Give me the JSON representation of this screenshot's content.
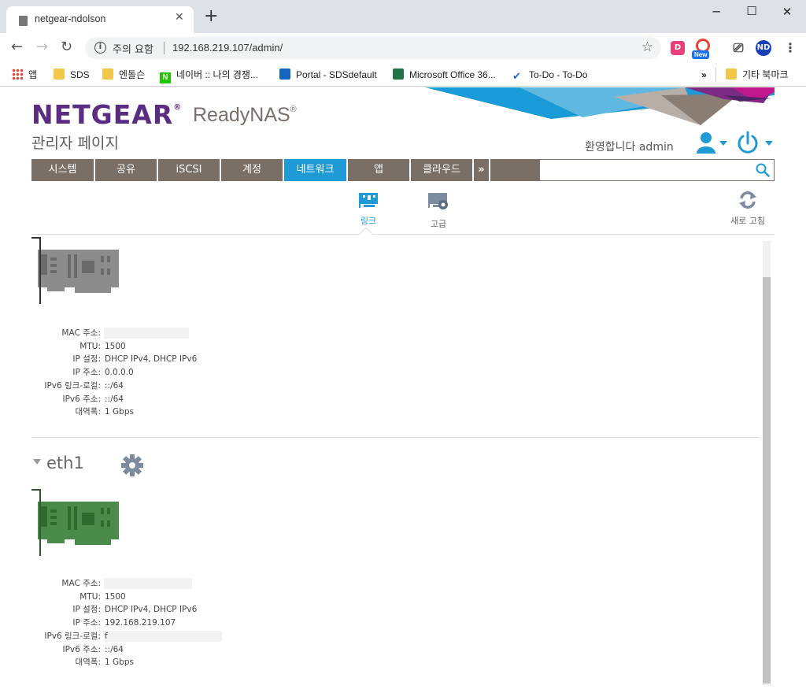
{
  "browser": {
    "tab_title": "netgear-ndolson",
    "security_status": "주의 요함",
    "url": "192.168.219.107/admin/",
    "ext_new_badge": "New",
    "profile_initials": "ND",
    "ext_d_label": "D"
  },
  "bookmarks": {
    "items": [
      {
        "label": "앱",
        "icon": "apps-grid-icon"
      },
      {
        "label": "SDS",
        "icon": "folder-icon"
      },
      {
        "label": "엔돌슨",
        "icon": "folder-icon"
      },
      {
        "label": "네이버 :: 나의 경쟁...",
        "icon": "naver-icon"
      },
      {
        "label": "Portal - SDSdefault",
        "icon": "portal-icon"
      },
      {
        "label": "Microsoft Office 36...",
        "icon": "office-icon"
      },
      {
        "label": "To-Do - To-Do",
        "icon": "todo-check-icon"
      }
    ],
    "overflow": "»",
    "other_bookmarks": "기타 북마크"
  },
  "header": {
    "logo": "NETGEAR",
    "logo_mark": "®",
    "product": "ReadyNAS",
    "product_mark": "®",
    "subtitle": "관리자 페이지",
    "welcome": "환영합니다 admin"
  },
  "nav": {
    "items": [
      {
        "label": "시스템"
      },
      {
        "label": "공유"
      },
      {
        "label": "iSCSI"
      },
      {
        "label": "계정"
      },
      {
        "label": "네트워크",
        "active": true
      },
      {
        "label": "앱"
      },
      {
        "label": "클라우드"
      }
    ],
    "more": "»"
  },
  "subnav": {
    "link_label": "링크",
    "advanced_label": "고급",
    "refresh_label": "새로 고침"
  },
  "colors": {
    "brand_purple": "#5b2d82",
    "nav_bg": "#7a6f67",
    "active_blue": "#1e9bd7",
    "card_gray": "#8c8c8c",
    "card_green": "#4a8a4a"
  },
  "interfaces": [
    {
      "name": "",
      "rows": [
        {
          "label": "MAC 주소:",
          "value": ""
        },
        {
          "label": "MTU:",
          "value": "1500"
        },
        {
          "label": "IP 설정:",
          "value": "DHCP IPv4, DHCP IPv6"
        },
        {
          "label": "IP 주소:",
          "value": "0.0.0.0"
        },
        {
          "label": "IPv6 링크-로컬:",
          "value": "::/64"
        },
        {
          "label": "IPv6 주소:",
          "value": "::/64"
        },
        {
          "label": "대역폭:",
          "value": "1 Gbps"
        }
      ]
    },
    {
      "name": "eth1",
      "rows": [
        {
          "label": "MAC 주소:",
          "value": ""
        },
        {
          "label": "MTU:",
          "value": "1500"
        },
        {
          "label": "IP 설정:",
          "value": "DHCP IPv4, DHCP IPv6"
        },
        {
          "label": "IP 주소:",
          "value": "192.168.219.107"
        },
        {
          "label": "IPv6 링크-로컬:",
          "value": "f"
        },
        {
          "label": "IPv6 주소:",
          "value": "::/64"
        },
        {
          "label": "대역폭:",
          "value": "1 Gbps"
        }
      ]
    }
  ]
}
